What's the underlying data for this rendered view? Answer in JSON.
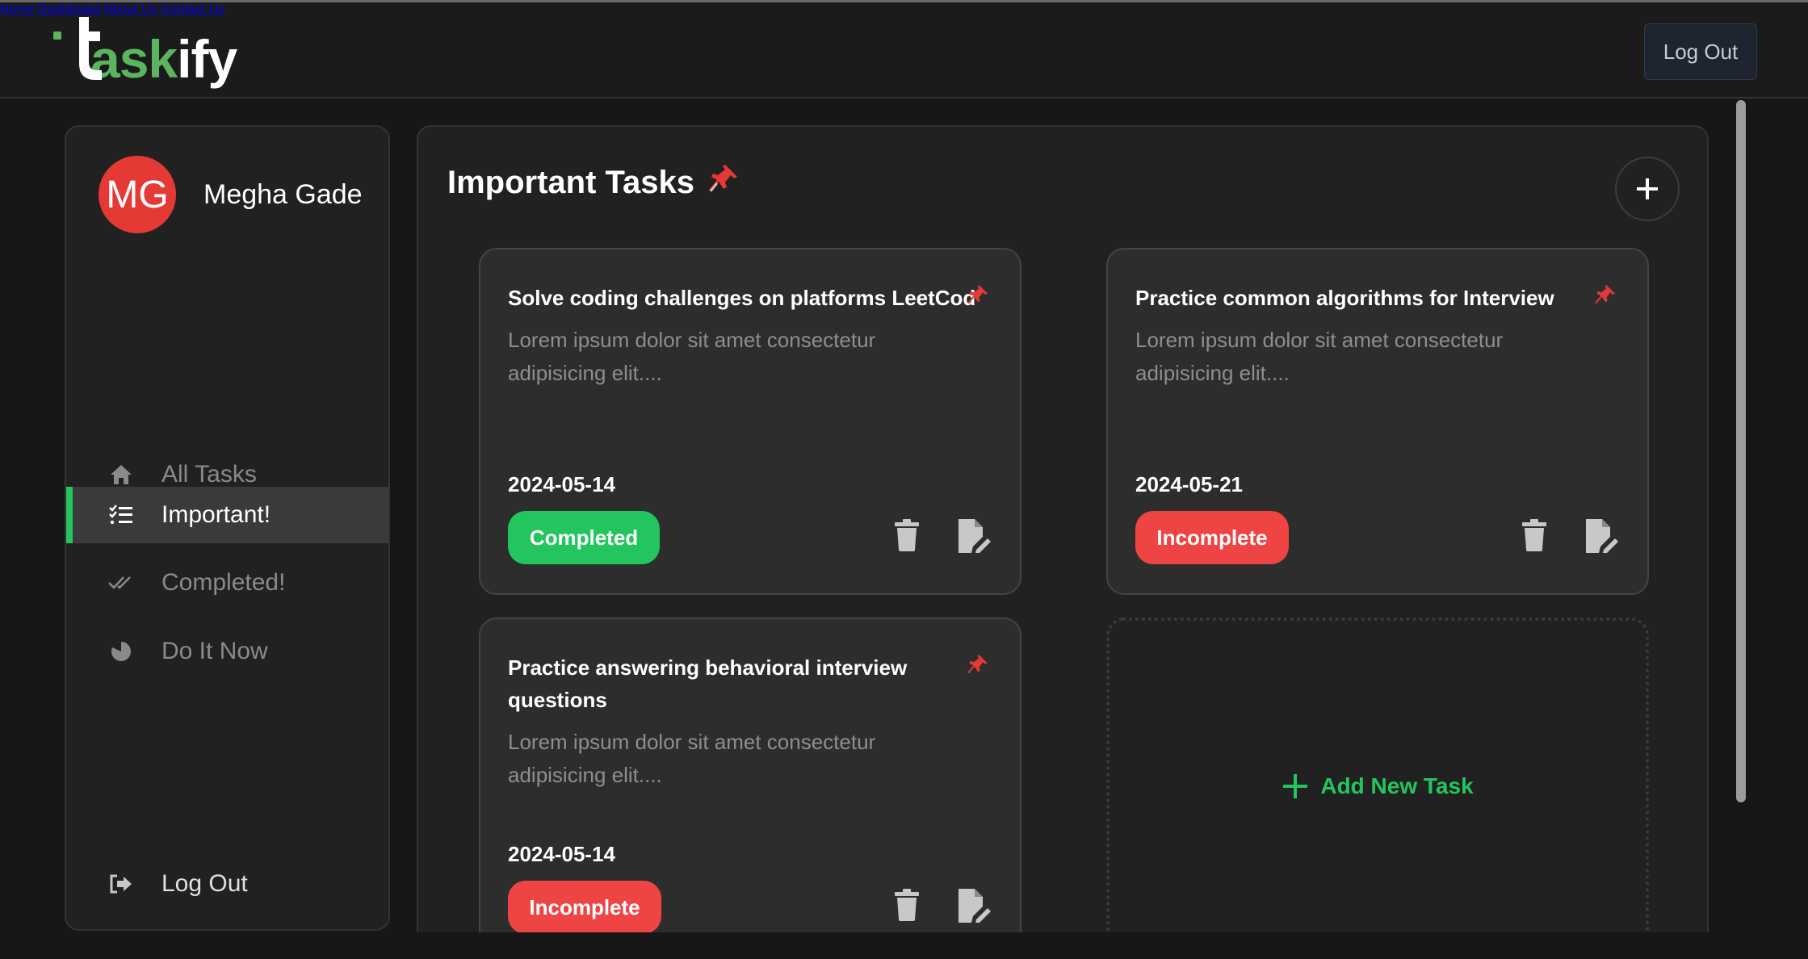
{
  "brand": {
    "logo_prefix": "t",
    "logo_green": "ask",
    "logo_white": "ify",
    "accent": "#5ab55e"
  },
  "nav": {
    "links": [
      "Home",
      "Dashboard",
      "About Us",
      "Contact Us"
    ],
    "logout": "Log Out"
  },
  "sidebar": {
    "avatar_initials": "MG",
    "avatar_color": "#e53935",
    "username": "Megha Gade",
    "items": [
      {
        "label": "All Tasks",
        "icon": "home-icon"
      },
      {
        "label": "Important!",
        "icon": "list-check-icon",
        "active": true
      },
      {
        "label": "Completed!",
        "icon": "double-check-icon"
      },
      {
        "label": "Do It Now",
        "icon": "pie-icon"
      }
    ],
    "logout": "Log Out"
  },
  "main": {
    "title": "Important Tasks",
    "title_emoji": "📌",
    "add_new_label": "Add New Task",
    "tasks": [
      {
        "title": "Solve coding challenges on platforms LeetCode",
        "description": "Lorem ipsum dolor sit amet consectetur adipisicing elit....",
        "date": "2024-05-14",
        "status": "Completed"
      },
      {
        "title": "Practice common algorithms for Interview",
        "description": "Lorem ipsum dolor sit amet consectetur adipisicing elit....",
        "date": "2024-05-21",
        "status": "Incomplete"
      },
      {
        "title": "Practice answering behavioral interview questions",
        "description": "Lorem ipsum dolor sit amet consectetur adipisicing elit....",
        "date": "2024-05-14",
        "status": "Incomplete"
      }
    ]
  },
  "colors": {
    "completed": "#22c55e",
    "incomplete": "#ef4444",
    "active_indicator": "#22c55e"
  }
}
